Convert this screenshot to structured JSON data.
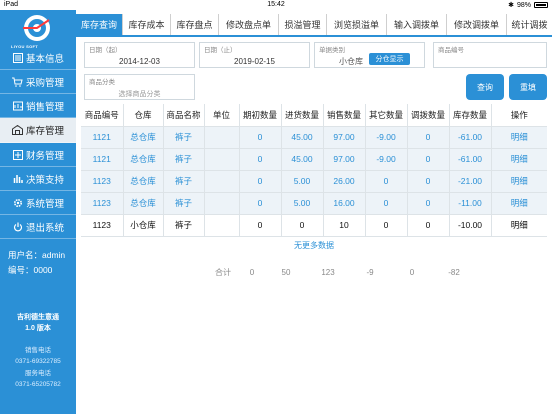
{
  "status_bar": {
    "device": "iPad",
    "time": "15:42",
    "battery": "98%"
  },
  "sidebar": {
    "logo_text": "LIYOU SOFT",
    "items": [
      {
        "label": "基本信息",
        "icon": "list-icon"
      },
      {
        "label": "采购管理",
        "icon": "cart-icon"
      },
      {
        "label": "销售管理",
        "icon": "sales-icon"
      },
      {
        "label": "库存管理",
        "icon": "warehouse-icon"
      },
      {
        "label": "财务管理",
        "icon": "finance-icon"
      },
      {
        "label": "决策支持",
        "icon": "chart-icon"
      },
      {
        "label": "系统管理",
        "icon": "gear-icon"
      },
      {
        "label": "退出系统",
        "icon": "power-icon"
      }
    ],
    "active_index": 3,
    "username_label": "用户名：admin",
    "number_label": "编号：0000",
    "version_line1": "吉利德生意通",
    "version_line2": "1.0 版本",
    "sales_phone_label": "销售电话",
    "sales_phone": "0371-69322785",
    "service_phone_label": "服务电话",
    "service_phone": "0371-65205782"
  },
  "tabs": [
    "库存查询",
    "库存成本",
    "库存盘点",
    "修改盘点单",
    "损溢管理",
    "浏览损溢单",
    "输入调拨单",
    "修改调拨单",
    "统计调拨"
  ],
  "active_tab": 0,
  "filters": {
    "date_from_label": "日期（起）",
    "date_from": "2014-12-03",
    "date_to_label": "日期（止）",
    "date_to": "2019-02-15",
    "doc_type_label": "单据类别",
    "doc_type": "小仓库",
    "doc_type_button": "分仓显示",
    "product_code_label": "商品编号",
    "product_code": "",
    "category_label": "商品分类",
    "category_placeholder": "选择商品分类",
    "query_button": "查询",
    "reset_button": "重填"
  },
  "table": {
    "headers": [
      "商品编号",
      "仓库",
      "商品名称",
      "单位",
      "期初数量",
      "进货数量",
      "销售数量",
      "其它数量",
      "调拨数量",
      "库存数量",
      "操作"
    ],
    "rows": [
      {
        "style": "blue",
        "cells": [
          "1121",
          "总仓库",
          "裤子",
          "",
          "0",
          "45.00",
          "97.00",
          "-9.00",
          "0",
          "-61.00",
          "明细"
        ]
      },
      {
        "style": "blue",
        "cells": [
          "1121",
          "总仓库",
          "裤子",
          "",
          "0",
          "45.00",
          "97.00",
          "-9.00",
          "0",
          "-61.00",
          "明细"
        ]
      },
      {
        "style": "blue",
        "cells": [
          "1123",
          "总仓库",
          "裤子",
          "",
          "0",
          "5.00",
          "26.00",
          "0",
          "0",
          "-21.00",
          "明细"
        ]
      },
      {
        "style": "blue",
        "cells": [
          "1123",
          "总仓库",
          "裤子",
          "",
          "0",
          "5.00",
          "16.00",
          "0",
          "0",
          "-11.00",
          "明细"
        ]
      },
      {
        "style": "plain",
        "cells": [
          "1123",
          "小仓库",
          "裤子",
          "",
          "0",
          "0",
          "10",
          "0",
          "0",
          "-10.00",
          "明细"
        ]
      }
    ],
    "no_more": "无更多数据",
    "totals_label": "合计",
    "totals": [
      "0",
      "50",
      "123",
      "-9",
      "0",
      "-82"
    ]
  },
  "colors": {
    "primary": "#2b90d6",
    "row_tint": "#edf3f8"
  }
}
